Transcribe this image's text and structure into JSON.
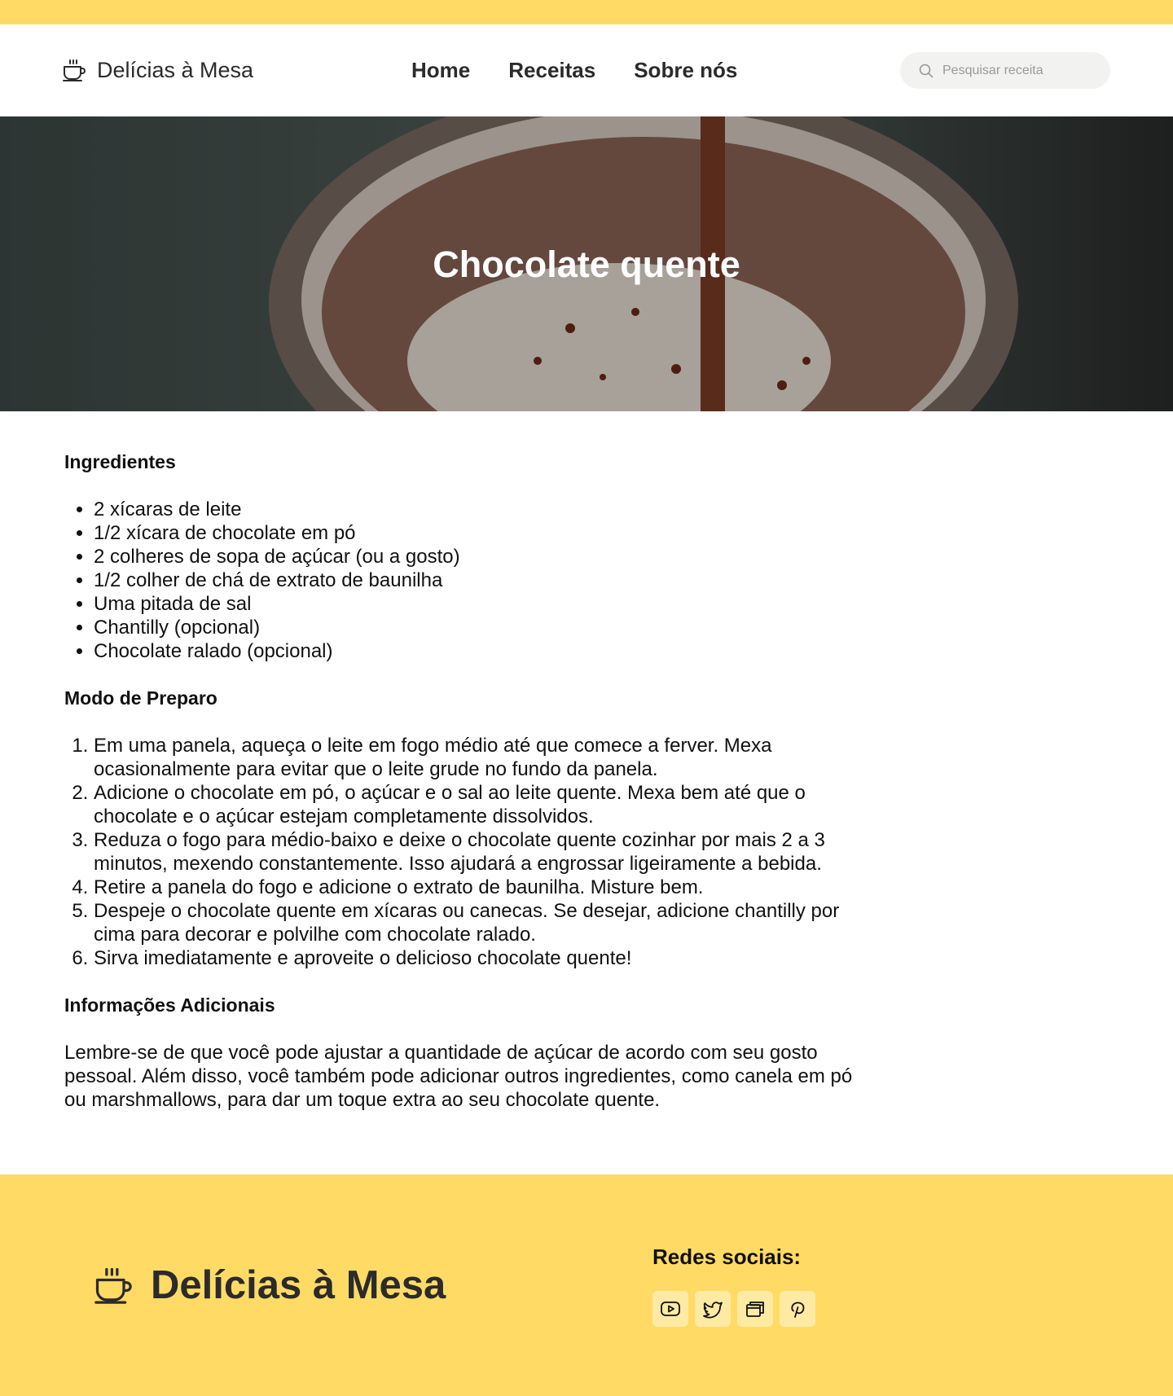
{
  "header": {
    "logo_text": "Delícias à Mesa",
    "logo_icon": "coffee-cup-icon",
    "nav": [
      {
        "label": "Home"
      },
      {
        "label": "Receitas"
      },
      {
        "label": "Sobre nós"
      }
    ],
    "search": {
      "placeholder": "Pesquisar receita",
      "icon": "search-icon"
    }
  },
  "hero": {
    "title": "Chocolate quente"
  },
  "recipe": {
    "ingredients_title": "Ingredientes",
    "ingredients": [
      "2 xícaras de leite",
      "1/2 xícara de chocolate em pó",
      "2 colheres de sopa de açúcar (ou a gosto)",
      "1/2 colher de chá de extrato de baunilha",
      "Uma pitada de sal",
      "Chantilly (opcional)",
      "Chocolate ralado (opcional)"
    ],
    "method_title": "Modo de Preparo",
    "steps": [
      "Em uma panela, aqueça o leite em fogo médio até que comece a ferver. Mexa ocasionalmente para evitar que o leite grude no fundo da panela.",
      "Adicione o chocolate em pó, o açúcar e o sal ao leite quente. Mexa bem até que o chocolate e o açúcar estejam completamente dissolvidos.",
      "Reduza o fogo para médio-baixo e deixe o chocolate quente cozinhar por mais 2 a 3 minutos, mexendo constantemente. Isso ajudará a engrossar ligeiramente a bebida.",
      "Retire a panela do fogo e adicione o extrato de baunilha. Misture bem.",
      "Despeje o chocolate quente em xícaras ou canecas. Se desejar, adicione chantilly por cima para decorar e polvilhe com chocolate ralado.",
      "Sirva imediatamente e aproveite o delicioso chocolate quente!"
    ],
    "info_title": "Informações Adicionais",
    "info_text": "Lembre-se de que você pode ajustar a quantidade de açúcar de acordo com seu gosto pessoal. Além disso, você também pode adicionar outros ingredientes, como canela em pó ou marshmallows, para dar um toque extra ao seu chocolate quente."
  },
  "footer": {
    "logo_text": "Delícias à Mesa",
    "social_title": "Redes sociais:",
    "social_icons": [
      "youtube-icon",
      "twitter-icon",
      "windows-icon",
      "pinterest-icon"
    ]
  },
  "colors": {
    "accent": "#ffdb66",
    "social_button": "#ffeaa3",
    "search_bg": "#f2f2f0",
    "text_dark": "#2b2b2b"
  }
}
